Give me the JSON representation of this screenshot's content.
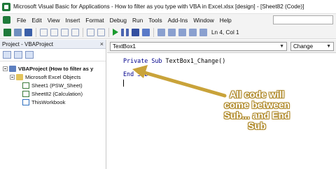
{
  "window": {
    "title": "Microsoft Visual Basic for Applications - How to filter as you type with VBA in Excel.xlsx [design] - [Sheet82 (Code)]"
  },
  "menu": {
    "items": [
      "File",
      "Edit",
      "View",
      "Insert",
      "Format",
      "Debug",
      "Run",
      "Tools",
      "Add-Ins",
      "Window",
      "Help"
    ]
  },
  "toolbar": {
    "position": "Ln 4, Col 1"
  },
  "project_pane": {
    "title": "Project - VBAProject",
    "close": "×",
    "tree": {
      "root": "VBAProject (How to filter as y",
      "folder": "Microsoft Excel Objects",
      "items": [
        "Sheet1 (PSW_Sheet)",
        "Sheet82 (Calculation)",
        "ThisWorkbook"
      ]
    }
  },
  "code_pane": {
    "object_dropdown": "TextBox1",
    "procedure_dropdown": "Change",
    "lines": {
      "line1_kw1": "Private",
      "line1_kw2": "Sub",
      "line1_rest": " TextBox1_Change()",
      "line2_kw": "End Sub"
    }
  },
  "callout": {
    "text": "All code will come between Sub... and End Sub",
    "color": "#c9a33a"
  }
}
